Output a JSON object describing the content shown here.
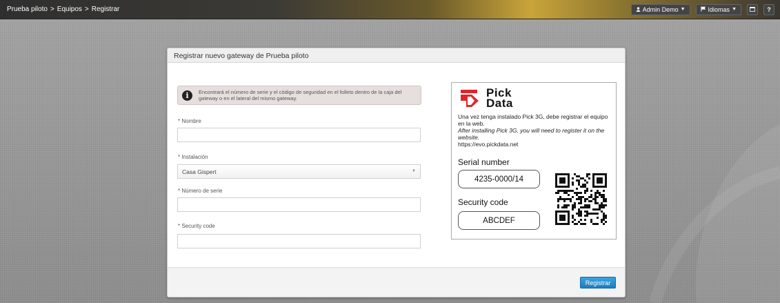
{
  "breadcrumb": [
    "Prueba piloto",
    "Equipos",
    "Registrar"
  ],
  "breadcrumb_sep": ">",
  "topbar": {
    "user_label": "Admin Demo",
    "lang_label": "Idiomas",
    "help_label": "?"
  },
  "panel": {
    "title": "Registrar nuevo gateway de Prueba piloto",
    "info_text": "Encontrará el número de serie y el código de seguridad en el folleto dentro de la caja del gateway o en el lateral del mismo gateway.",
    "fields": {
      "nombre_label": "* Nombre",
      "instalacion_label": "* Instalación",
      "instalacion_value": "Casa Gispert",
      "serie_label": "* Número de serie",
      "security_label": "* Security code"
    },
    "submit_label": "Registrar"
  },
  "card": {
    "logo_line1": "Pick",
    "logo_line2": "Data",
    "text_es": "Una vez tenga instalado Pick 3G, debe registrar el equipo en la web.",
    "text_en": "After installing Pick 3G, you will need to register it on the website.",
    "url": "https://evo.pickdata.net",
    "serial_title": "Serial number",
    "serial_value": "4235-0000/14",
    "security_title": "Security code",
    "security_value": "ABCDEF"
  },
  "colors": {
    "accent": "#1c7cc0",
    "logo_red": "#e0242b"
  },
  "icons": [
    "user-icon",
    "flag-icon",
    "window-icon",
    "info-icon",
    "qr-code-icon"
  ]
}
